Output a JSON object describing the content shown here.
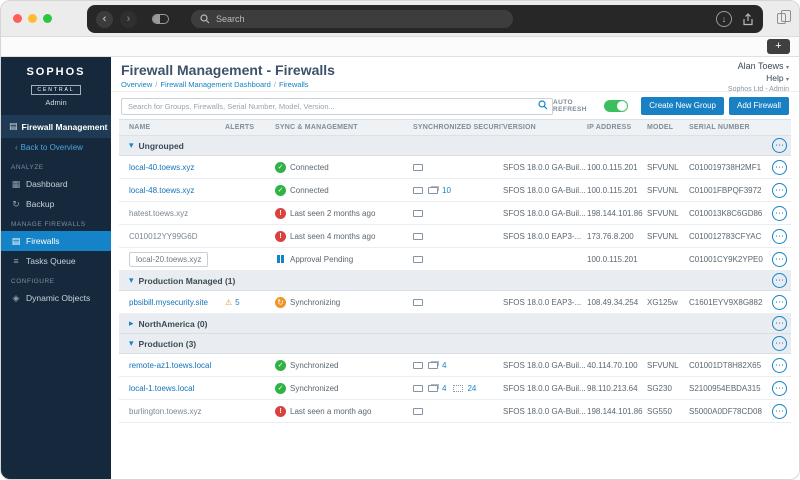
{
  "browser": {
    "search_placeholder": "Search",
    "new_tab_label": "+"
  },
  "sidebar": {
    "brand_name": "SOPHOS",
    "brand_sub": "CENTRAL",
    "brand_role": "Admin",
    "app_title": "Firewall Management",
    "back_link": "Back to Overview",
    "sections": [
      {
        "label": "ANALYZE",
        "items": [
          {
            "label": "Dashboard"
          },
          {
            "label": "Backup"
          }
        ]
      },
      {
        "label": "MANAGE FIREWALLS",
        "items": [
          {
            "label": "Firewalls"
          },
          {
            "label": "Tasks Queue"
          }
        ]
      },
      {
        "label": "CONFIGURE",
        "items": [
          {
            "label": "Dynamic Objects"
          }
        ]
      }
    ]
  },
  "header": {
    "title": "Firewall Management - Firewalls",
    "breadcrumbs": [
      "Overview",
      "Firewall Management Dashboard",
      "Firewalls"
    ],
    "user_menu": "Alan Toews",
    "help_menu": "Help",
    "account": "Sophos Ltd - Admin"
  },
  "toolbar": {
    "search_placeholder": "Search for Groups, Firewalls, Serial Number, Model, Version...",
    "auto_refresh_label": "AUTO REFRESH",
    "auto_refresh_on": true,
    "create_group_label": "Create New Group",
    "add_firewall_label": "Add Firewall"
  },
  "table": {
    "columns": [
      "NAME",
      "ALERTS",
      "SYNC & MANAGEMENT",
      "SYNCHRONIZED SECURITY",
      "VERSION",
      "IP ADDRESS",
      "MODEL",
      "SERIAL NUMBER"
    ],
    "groups": [
      {
        "name": "Ungrouped",
        "expanded": true,
        "rows": [
          {
            "name": "local-40.toews.xyz",
            "name_style": "link",
            "status": {
              "type": "connected",
              "label": "Connected"
            },
            "security": [
              {
                "kind": "monitor"
              }
            ],
            "version": "SFOS 18.0.0 GA-Buil...",
            "ip": "100.0.115.201",
            "model": "SFVUNL",
            "serial": "C010019738H2MF1"
          },
          {
            "name": "local-48.toews.xyz",
            "name_style": "link",
            "status": {
              "type": "connected",
              "label": "Connected"
            },
            "security": [
              {
                "kind": "monitor"
              },
              {
                "kind": "screens",
                "count": "10"
              }
            ],
            "version": "SFOS 18.0.0 GA-Buil...",
            "ip": "100.0.115.201",
            "model": "SFVUNL",
            "serial": "C01001FBPQF3972"
          },
          {
            "name": "hatest.toews.xyz",
            "name_style": "plain",
            "status": {
              "type": "lastseen",
              "label": "Last seen 2 months ago"
            },
            "security": [
              {
                "kind": "monitor"
              }
            ],
            "version": "SFOS 18.0.0 GA-Buil...",
            "ip": "198.144.101.86",
            "model": "SFVUNL",
            "serial": "C010013K8C6GD86"
          },
          {
            "name": "C010012YY99G6D",
            "name_style": "plain",
            "status": {
              "type": "lastseen",
              "label": "Last seen 4 months ago"
            },
            "security": [
              {
                "kind": "monitor"
              }
            ],
            "version": "SFOS 18.0.0 EAP3-...",
            "ip": "173.76.8.200",
            "model": "SFVUNL",
            "serial": "C010012783CFYAC"
          },
          {
            "name": "local-20.toews.xyz",
            "name_style": "boxed",
            "status": {
              "type": "pending",
              "label": "Approval Pending"
            },
            "security": [
              {
                "kind": "monitor"
              }
            ],
            "version": "",
            "ip": "100.0.115.201",
            "model": "",
            "serial": "C01001CY9K2YPE0"
          }
        ]
      },
      {
        "name": "Production Managed (1)",
        "expanded": true,
        "rows": [
          {
            "name": "pbsibill.mysecurity.site",
            "name_style": "link",
            "alerts": "5",
            "status": {
              "type": "synchronizing",
              "label": "Synchronizing"
            },
            "security": [
              {
                "kind": "monitor"
              }
            ],
            "version": "SFOS 18.0.0 EAP3-...",
            "ip": "108.49.34.254",
            "model": "XG125w",
            "serial": "C1601EYV9X8G882"
          }
        ]
      },
      {
        "name": "NorthAmerica (0)",
        "expanded": false,
        "rows": []
      },
      {
        "name": "Production (3)",
        "expanded": true,
        "rows": [
          {
            "name": "remote-az1.toews.local",
            "name_style": "link",
            "status": {
              "type": "synchronized",
              "label": "Synchronized"
            },
            "security": [
              {
                "kind": "monitor"
              },
              {
                "kind": "screens",
                "count": "4"
              }
            ],
            "version": "SFOS 18.0.0 GA-Buil...",
            "ip": "40.114.70.100",
            "model": "SFVUNL",
            "serial": "C01001DT8H82X65"
          },
          {
            "name": "local-1.toews.local",
            "name_style": "link",
            "status": {
              "type": "synchronized",
              "label": "Synchronized"
            },
            "security": [
              {
                "kind": "monitor"
              },
              {
                "kind": "screens",
                "count": "4"
              },
              {
                "kind": "grid",
                "count": "24"
              }
            ],
            "version": "SFOS 18.0.0 GA-Buil...",
            "ip": "98.110.213.64",
            "model": "SG230",
            "serial": "S2100954EBDA315"
          },
          {
            "name": "burlington.toews.xyz",
            "name_style": "plain",
            "status": {
              "type": "lastseen",
              "label": "Last seen a month ago"
            },
            "security": [
              {
                "kind": "monitor"
              }
            ],
            "version": "SFOS 18.0.0 GA-Buil...",
            "ip": "198.144.101.86",
            "model": "SG550",
            "serial": "S5000A0DF78CD08"
          }
        ]
      }
    ]
  },
  "colors": {
    "accent_blue": "#1583c7",
    "ok_green": "#2eb344",
    "error_red": "#d9433f",
    "warn_orange": "#f29424",
    "toggle_green": "#3dbf5f",
    "sidebar_bg": "#16293c"
  }
}
